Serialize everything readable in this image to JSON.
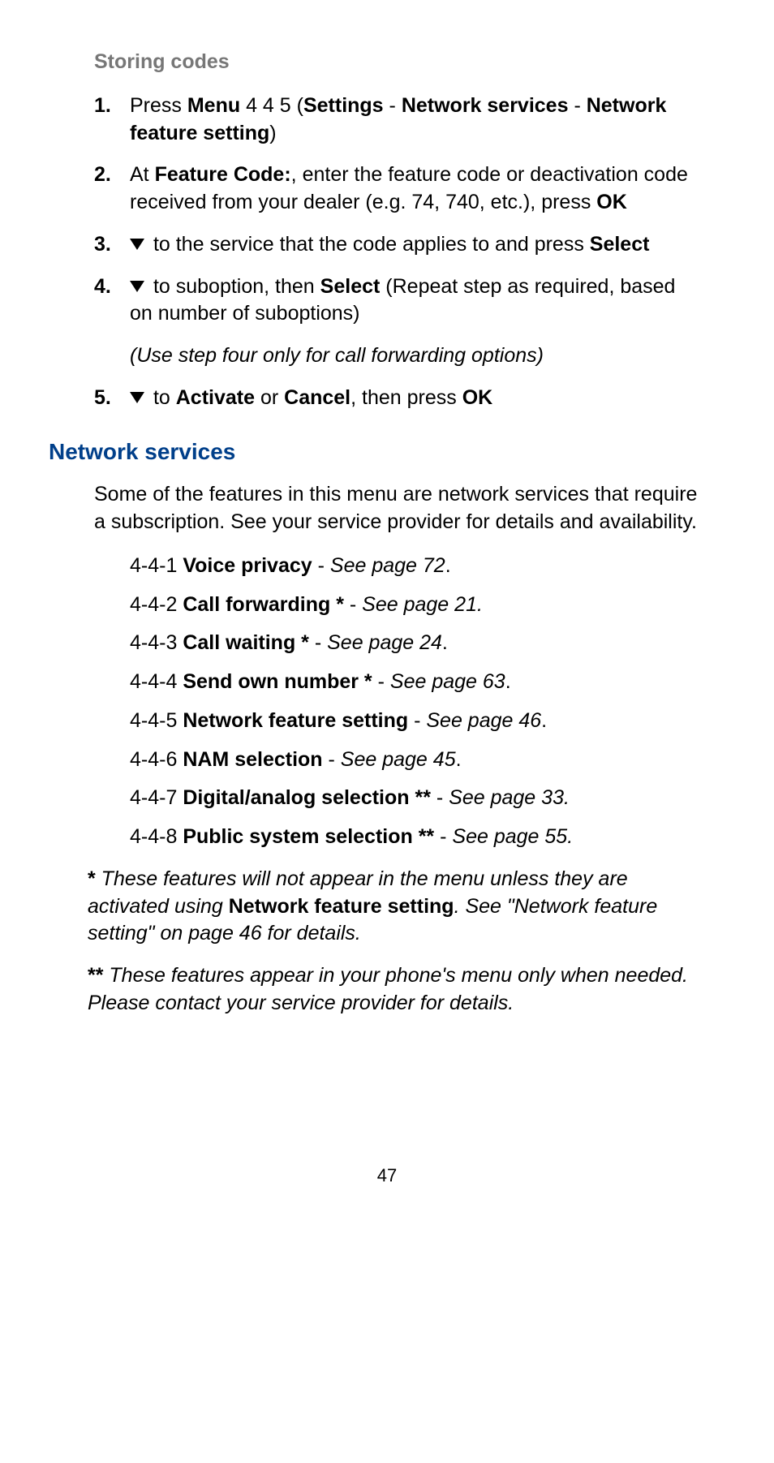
{
  "subheading": "Storing codes",
  "steps": [
    {
      "num": "1.",
      "parts": [
        {
          "t": "Press ",
          "b": false
        },
        {
          "t": "Menu",
          "b": true
        },
        {
          "t": " 4 4 5 (",
          "b": false
        },
        {
          "t": "Settings",
          "b": true
        },
        {
          "t": " - ",
          "b": false
        },
        {
          "t": "Network services",
          "b": true
        },
        {
          "t": " - ",
          "b": false
        },
        {
          "t": "Network feature setting",
          "b": true
        },
        {
          "t": ")",
          "b": false
        }
      ]
    },
    {
      "num": "2.",
      "parts": [
        {
          "t": "At ",
          "b": false
        },
        {
          "t": "Feature Code:",
          "b": true
        },
        {
          "t": ", enter the feature code or deactivation code received from your dealer (e.g.  74,  740, etc.), press ",
          "b": false
        },
        {
          "t": "OK",
          "b": true
        }
      ]
    },
    {
      "num": "3.",
      "tri": true,
      "parts": [
        {
          "t": " to the service that the code applies to and press ",
          "b": false
        },
        {
          "t": "Select",
          "b": true
        }
      ]
    },
    {
      "num": "4.",
      "tri": true,
      "parts": [
        {
          "t": " to suboption, then ",
          "b": false
        },
        {
          "t": "Select",
          "b": true
        },
        {
          "t": " (Repeat step as required, based on number of suboptions)",
          "b": false
        }
      ],
      "note": "(Use step four only for call forwarding options)"
    },
    {
      "num": "5.",
      "tri": true,
      "parts": [
        {
          "t": " to ",
          "b": false
        },
        {
          "t": "Activate",
          "b": true
        },
        {
          "t": " or ",
          "b": false
        },
        {
          "t": "Cancel",
          "b": true
        },
        {
          "t": ", then press ",
          "b": false
        },
        {
          "t": "OK",
          "b": true
        }
      ]
    }
  ],
  "heading": "Network services",
  "intro": "Some of the features in this menu are network services that require a subscription. See your service provider for details and availability.",
  "menu": [
    {
      "code": "4-4-1",
      "name": "Voice privacy",
      "ref": "See page 72",
      "end": "."
    },
    {
      "code": "4-4-2",
      "name": "Call forwarding *",
      "ref": "See page 21.",
      "end": ""
    },
    {
      "code": "4-4-3",
      "name": "Call waiting *",
      "ref": "See page 24",
      "end": "."
    },
    {
      "code": "4-4-4",
      "name": "Send own number *",
      "ref": "See page 63",
      "end": "."
    },
    {
      "code": "4-4-5",
      "name": "Network feature setting",
      "ref": "See page 46",
      "end": "."
    },
    {
      "code": "4-4-6",
      "name": "NAM selection",
      "ref": "See page 45",
      "end": "."
    },
    {
      "code": "4-4-7",
      "name": "Digital/analog selection **",
      "ref": "See page 33.",
      "end": ""
    },
    {
      "code": "4-4-8",
      "name": "Public system selection **",
      "ref": "See page 55.",
      "end": ""
    }
  ],
  "footnote1": {
    "mark": "*",
    "pre": " These features will not appear in the menu unless they are activated using ",
    "bold": "Network feature setting",
    "post": ". See \"Network feature setting\" on page 46 for details."
  },
  "footnote2": {
    "mark": "**",
    "text": " These features appear in your phone's menu only when needed. Please contact your service provider for details."
  },
  "pageNumber": "47"
}
